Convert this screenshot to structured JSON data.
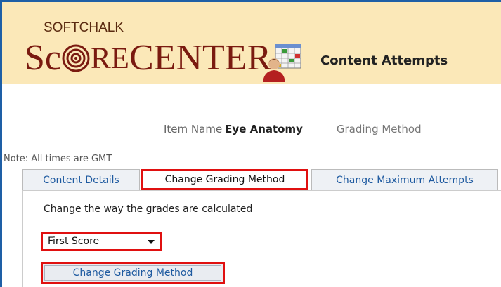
{
  "header": {
    "logo_small": "SOFTCHALK",
    "logo_sc": "Sc",
    "logo_re": "RE",
    "logo_center": "CENTER",
    "title": "Content Attempts"
  },
  "item": {
    "name_label": "Item Name",
    "name_value": "Eye Anatomy",
    "grading_label": "Grading Method"
  },
  "note": "Note: All times are GMT",
  "tabs": [
    {
      "label": "Content Details"
    },
    {
      "label": "Change Grading Method",
      "active": true
    },
    {
      "label": "Change Maximum Attempts"
    }
  ],
  "content": {
    "description": "Change the way the grades are calculated",
    "select_value": "First Score",
    "button_label": "Change Grading Method"
  },
  "colors": {
    "frame": "#1e5fa6",
    "header_bg": "#fbe8b8",
    "highlight": "#e01010",
    "link": "#1e5aa0"
  }
}
